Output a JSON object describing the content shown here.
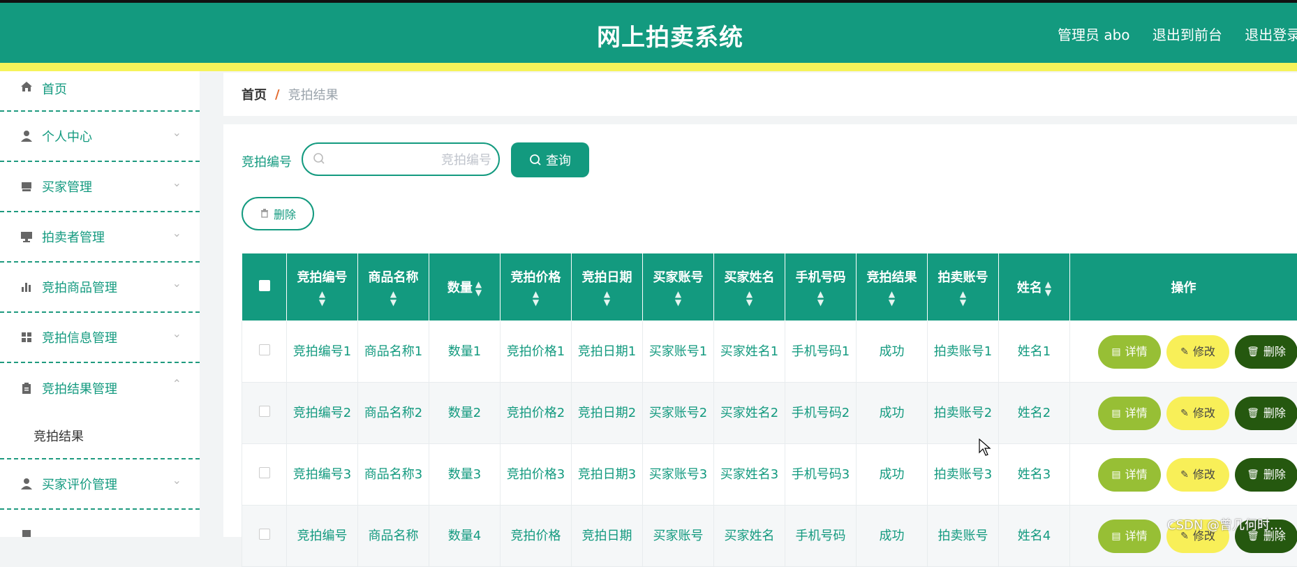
{
  "header": {
    "title": "网上拍卖系统",
    "admin": "管理员 abo",
    "to_front": "退出到前台",
    "logout": "退出登录"
  },
  "sidebar": {
    "items": [
      {
        "label": "首页",
        "icon": "home-icon"
      },
      {
        "label": "个人中心",
        "icon": "user-icon"
      },
      {
        "label": "买家管理",
        "icon": "monitor-icon"
      },
      {
        "label": "拍卖者管理",
        "icon": "desktop-icon"
      },
      {
        "label": "竞拍商品管理",
        "icon": "bar-chart-icon"
      },
      {
        "label": "竞拍信息管理",
        "icon": "grid-icon"
      },
      {
        "label": "竞拍结果管理",
        "icon": "clipboard-icon"
      },
      {
        "label": "买家评价管理",
        "icon": "user-icon"
      },
      {
        "label": "",
        "icon": "clipboard-icon"
      }
    ],
    "submenu": "竞拍结果"
  },
  "breadcrumb": {
    "home": "首页",
    "sep": "/",
    "current": "竞拍结果"
  },
  "search": {
    "label": "竞拍编号",
    "placeholder": "竞拍编号",
    "query_button": "查询"
  },
  "toolbar": {
    "delete_button": "删除"
  },
  "table": {
    "columns": [
      "竞拍编号",
      "商品名称",
      "数量",
      "竞拍价格",
      "竞拍日期",
      "买家账号",
      "买家姓名",
      "手机号码",
      "竞拍结果",
      "拍卖账号",
      "姓名",
      "操作"
    ],
    "rows": [
      [
        "竞拍编号1",
        "商品名称1",
        "数量1",
        "竞拍价格1",
        "竞拍日期1",
        "买家账号1",
        "买家姓名1",
        "手机号码1",
        "成功",
        "拍卖账号1",
        "姓名1"
      ],
      [
        "竞拍编号2",
        "商品名称2",
        "数量2",
        "竞拍价格2",
        "竞拍日期2",
        "买家账号2",
        "买家姓名2",
        "手机号码2",
        "成功",
        "拍卖账号2",
        "姓名2"
      ],
      [
        "竞拍编号3",
        "商品名称3",
        "数量3",
        "竞拍价格3",
        "竞拍日期3",
        "买家账号3",
        "买家姓名3",
        "手机号码3",
        "成功",
        "拍卖账号3",
        "姓名3"
      ],
      [
        "竞拍编号",
        "商品名称",
        "数量4",
        "竞拍价格",
        "竞拍日期",
        "买家账号",
        "买家姓名",
        "手机号码",
        "成功",
        "拍卖账号",
        "姓名4"
      ]
    ],
    "actions": {
      "detail": "详情",
      "edit": "修改",
      "delete": "删除"
    }
  },
  "watermark": "CSDN @曾几何时…",
  "colors": {
    "primary": "#139a7f",
    "accent_bar": "#f6f35a",
    "detail": "#97bf35",
    "edit": "#f8ef58",
    "delete": "#25580f"
  }
}
